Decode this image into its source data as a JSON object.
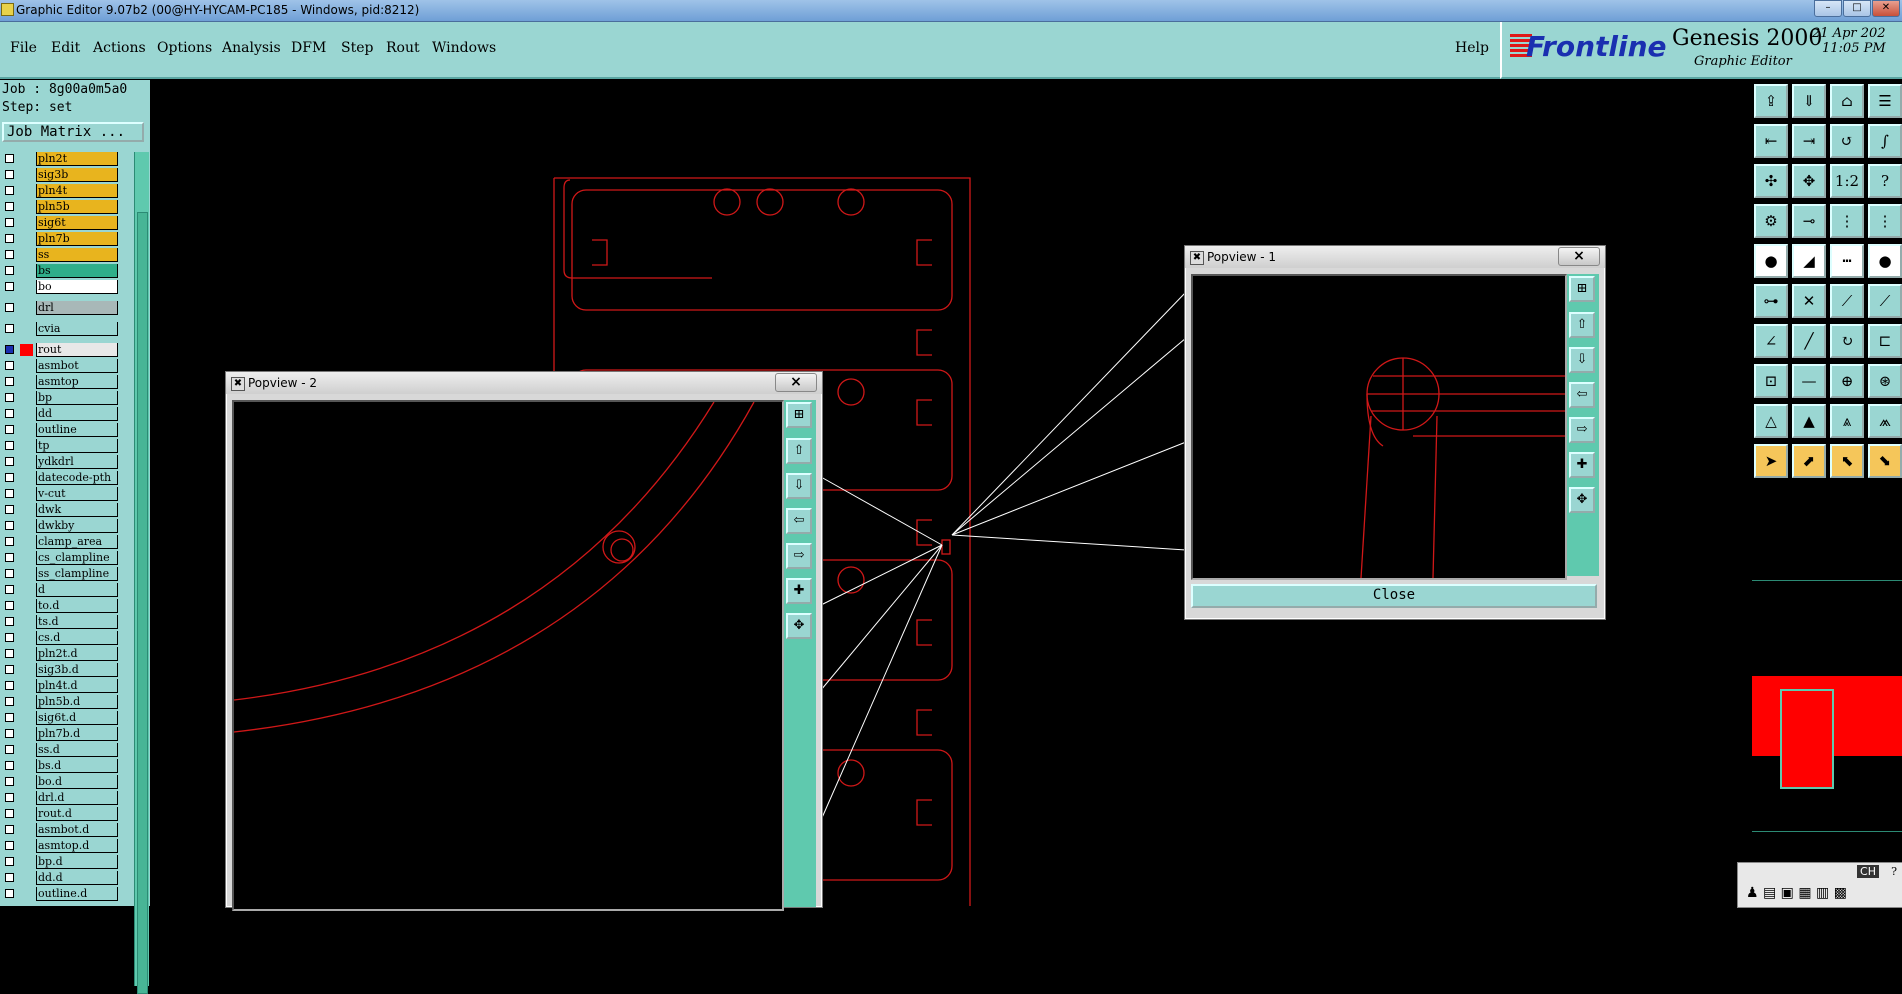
{
  "window": {
    "title": "Graphic Editor 9.07b2 (00@HY-HYCAM-PC185 - Windows, pid:8212)"
  },
  "menu": [
    {
      "label": "File"
    },
    {
      "label": "Edit"
    },
    {
      "label": "Actions"
    },
    {
      "label": "Options"
    },
    {
      "label": "Analysis"
    },
    {
      "label": "DFM"
    },
    {
      "label": "Step"
    },
    {
      "label": "Rout"
    },
    {
      "label": "Windows"
    }
  ],
  "help": "Help",
  "brand": {
    "frontline": "Frontline",
    "product": "Genesis 2000",
    "subtitle": "Graphic Editor",
    "date": "21 Apr 202",
    "time": "11:05 PM"
  },
  "job": {
    "job_line": "Job : 8g00a0m5a0",
    "step_line": "Step: set",
    "matrix_button": "Job Matrix ..."
  },
  "layers": [
    {
      "name": "pln2t",
      "color": "#e8b41e"
    },
    {
      "name": "sig3b",
      "color": "#e8b41e"
    },
    {
      "name": "pln4t",
      "color": "#e8b41e"
    },
    {
      "name": "pln5b",
      "color": "#e8b41e"
    },
    {
      "name": "sig6t",
      "color": "#e8b41e"
    },
    {
      "name": "pln7b",
      "color": "#e8b41e"
    },
    {
      "name": "ss",
      "color": "#e8b41e"
    },
    {
      "name": "bs",
      "color": "#2fae8a"
    },
    {
      "name": "bo",
      "color": "#ffffff"
    },
    {
      "name": "drl",
      "color": "#a8b8b8"
    },
    {
      "name": "cvia",
      "color": "#9ad6d2"
    },
    {
      "name": "rout",
      "color": "#e8e8e8"
    },
    {
      "name": "asmbot",
      "color": "#9ad6d2"
    },
    {
      "name": "asmtop",
      "color": "#9ad6d2"
    },
    {
      "name": "bp",
      "color": "#9ad6d2"
    },
    {
      "name": "dd",
      "color": "#9ad6d2"
    },
    {
      "name": "outline",
      "color": "#9ad6d2"
    },
    {
      "name": "tp",
      "color": "#9ad6d2"
    },
    {
      "name": "ydkdrl",
      "color": "#9ad6d2"
    },
    {
      "name": "datecode-pth",
      "color": "#9ad6d2"
    },
    {
      "name": "v-cut",
      "color": "#9ad6d2"
    },
    {
      "name": "dwk",
      "color": "#9ad6d2"
    },
    {
      "name": "dwkby",
      "color": "#9ad6d2"
    },
    {
      "name": "clamp_area",
      "color": "#9ad6d2"
    },
    {
      "name": "cs_clampline",
      "color": "#9ad6d2"
    },
    {
      "name": "ss_clampline",
      "color": "#9ad6d2"
    },
    {
      "name": "d",
      "color": "#9ad6d2"
    },
    {
      "name": "to.d",
      "color": "#9ad6d2"
    },
    {
      "name": "ts.d",
      "color": "#9ad6d2"
    },
    {
      "name": "cs.d",
      "color": "#9ad6d2"
    },
    {
      "name": "pln2t.d",
      "color": "#9ad6d2"
    },
    {
      "name": "sig3b.d",
      "color": "#9ad6d2"
    },
    {
      "name": "pln4t.d",
      "color": "#9ad6d2"
    },
    {
      "name": "pln5b.d",
      "color": "#9ad6d2"
    },
    {
      "name": "sig6t.d",
      "color": "#9ad6d2"
    },
    {
      "name": "pln7b.d",
      "color": "#9ad6d2"
    },
    {
      "name": "ss.d",
      "color": "#9ad6d2"
    },
    {
      "name": "bs.d",
      "color": "#9ad6d2"
    },
    {
      "name": "bo.d",
      "color": "#9ad6d2"
    },
    {
      "name": "drl.d",
      "color": "#9ad6d2"
    },
    {
      "name": "rout.d",
      "color": "#9ad6d2"
    },
    {
      "name": "asmbot.d",
      "color": "#9ad6d2"
    },
    {
      "name": "asmtop.d",
      "color": "#9ad6d2"
    },
    {
      "name": "bp.d",
      "color": "#9ad6d2"
    },
    {
      "name": "dd.d",
      "color": "#9ad6d2"
    },
    {
      "name": "outline.d",
      "color": "#9ad6d2"
    }
  ],
  "popview1": {
    "title": "Popview - 1",
    "close_label": "Close"
  },
  "popview2": {
    "title": "Popview - 2"
  },
  "tray": {
    "lang": "CH"
  },
  "colors": {
    "panel": "#9ad6d2",
    "accent": "#5fc9ae",
    "board_outline": "#d01818",
    "highlight": "#ff0000"
  }
}
